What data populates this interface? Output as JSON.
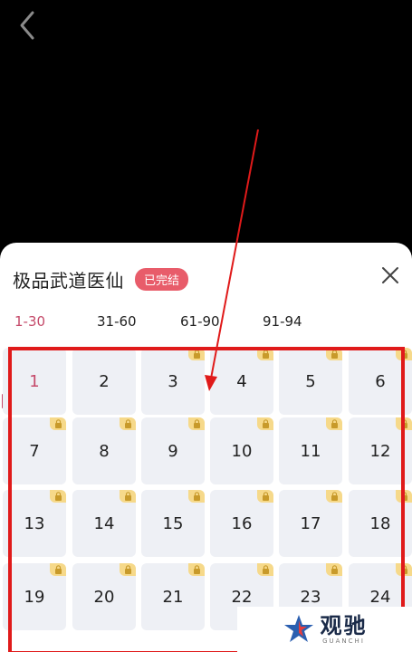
{
  "header": {
    "back_icon": "chevron-left-icon"
  },
  "sheet": {
    "title": "极品武道医仙",
    "status_badge": "已完结",
    "close_icon": "close-icon"
  },
  "tabs": [
    {
      "label": "1-30",
      "active": true
    },
    {
      "label": "31-60",
      "active": false
    },
    {
      "label": "61-90",
      "active": false
    },
    {
      "label": "91-94",
      "active": false
    }
  ],
  "episodes": [
    {
      "number": "1",
      "locked": false,
      "current": true
    },
    {
      "number": "2",
      "locked": false,
      "current": false
    },
    {
      "number": "3",
      "locked": true,
      "current": false
    },
    {
      "number": "4",
      "locked": true,
      "current": false
    },
    {
      "number": "5",
      "locked": true,
      "current": false
    },
    {
      "number": "6",
      "locked": true,
      "current": false
    },
    {
      "number": "7",
      "locked": true,
      "current": false
    },
    {
      "number": "8",
      "locked": true,
      "current": false
    },
    {
      "number": "9",
      "locked": true,
      "current": false
    },
    {
      "number": "10",
      "locked": true,
      "current": false
    },
    {
      "number": "11",
      "locked": true,
      "current": false
    },
    {
      "number": "12",
      "locked": true,
      "current": false
    },
    {
      "number": "13",
      "locked": true,
      "current": false
    },
    {
      "number": "14",
      "locked": true,
      "current": false
    },
    {
      "number": "15",
      "locked": true,
      "current": false
    },
    {
      "number": "16",
      "locked": true,
      "current": false
    },
    {
      "number": "17",
      "locked": true,
      "current": false
    },
    {
      "number": "18",
      "locked": true,
      "current": false
    },
    {
      "number": "19",
      "locked": true,
      "current": false
    },
    {
      "number": "20",
      "locked": true,
      "current": false
    },
    {
      "number": "21",
      "locked": true,
      "current": false
    },
    {
      "number": "22",
      "locked": true,
      "current": false
    },
    {
      "number": "23",
      "locked": true,
      "current": false
    },
    {
      "number": "24",
      "locked": true,
      "current": false
    }
  ],
  "colors": {
    "accent": "#c54a6a",
    "badge_bg": "#e85c6a",
    "cell_bg": "#eef0f5",
    "lock_bg": "#f6d98a",
    "annotation_red": "#e01a1a"
  },
  "watermark": {
    "text": "观驰",
    "sub": "GUANCHI"
  }
}
